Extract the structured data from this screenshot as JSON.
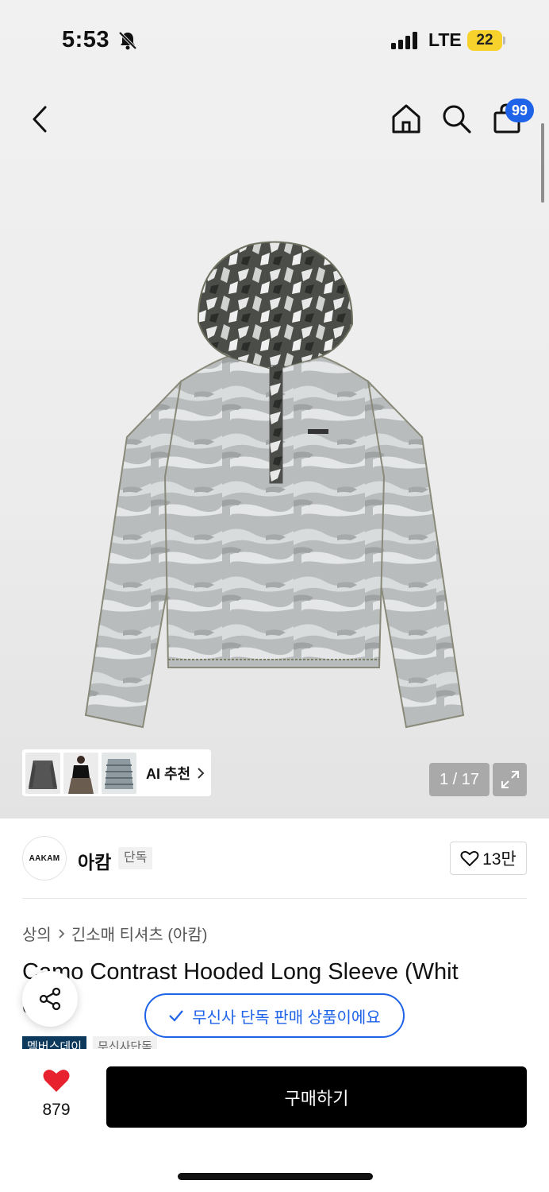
{
  "status_bar": {
    "time": "5:53",
    "network": "LTE",
    "battery": "22"
  },
  "nav": {
    "cart_count": "99"
  },
  "ai_recommend": {
    "label": "AI 추천"
  },
  "gallery": {
    "pager": "1 / 17"
  },
  "brand": {
    "logo_text": "AAKAM",
    "name": "아캄",
    "badge": "단독",
    "likes": "13만"
  },
  "breadcrumb": {
    "category": "상의",
    "subcategory": "긴소매 티셔츠 (아캄)"
  },
  "product": {
    "title": "Camo Contrast Hooded Long Sleeve (Whit",
    "title_line2": "e)"
  },
  "exclusive_notice": "무신사 단독 판매 상품이에요",
  "tags": [
    "멤버스데이",
    "무신사단독"
  ],
  "bottom": {
    "wish_count": "879",
    "buy_label": "구매하기"
  },
  "colors": {
    "accent": "#1e63e8",
    "battery": "#f7d22c",
    "tag_dark": "#0d3a5c",
    "heart": "#e8212f"
  }
}
